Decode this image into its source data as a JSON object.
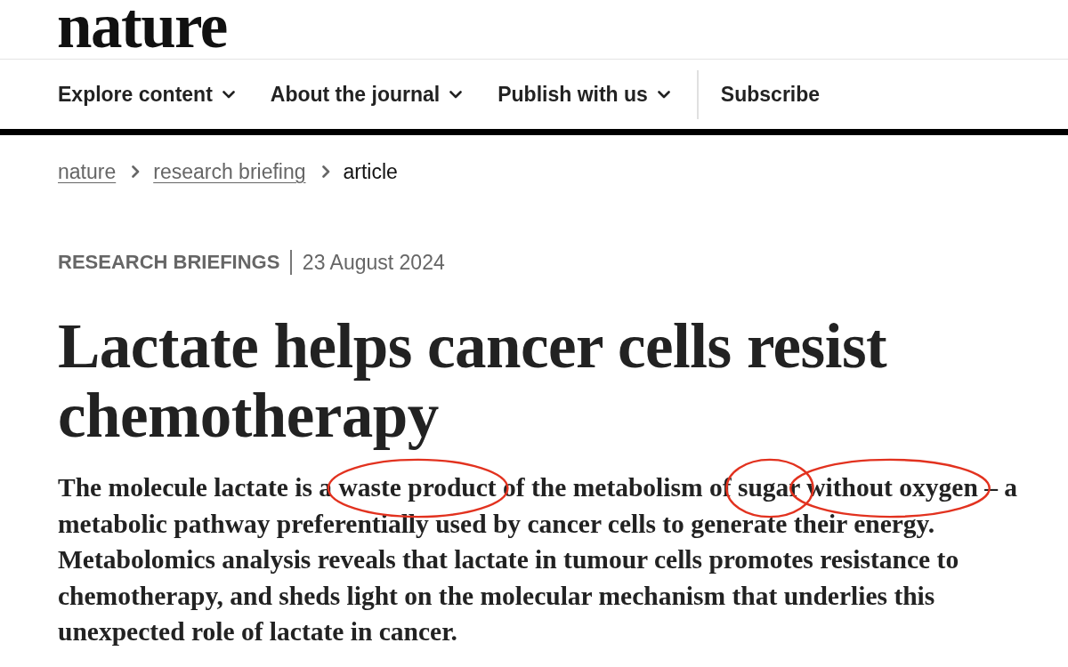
{
  "header": {
    "logo": "nature"
  },
  "nav": {
    "items": [
      {
        "label": "Explore content",
        "kind": "menu"
      },
      {
        "label": "About the journal",
        "kind": "menu"
      },
      {
        "label": "Publish with us",
        "kind": "menu"
      },
      {
        "label": "Subscribe",
        "kind": "link"
      }
    ]
  },
  "breadcrumb": [
    {
      "label": "nature",
      "kind": "link"
    },
    {
      "label": "research briefing",
      "kind": "link"
    },
    {
      "label": "article",
      "kind": "current"
    }
  ],
  "article": {
    "type": "RESEARCH BRIEFINGS",
    "date": "23 August 2024",
    "title": "Lactate helps cancer cells resist chemotherapy",
    "standfirst": [
      {
        "text": "The molecule lactate is a ",
        "circled": false
      },
      {
        "text": "waste product",
        "circled": true
      },
      {
        "text": " of the metabolism of ",
        "circled": false
      },
      {
        "text": "sugar",
        "circled": true
      },
      {
        "text": " without oxygen",
        "circled": true
      },
      {
        "text": " – a metabolic pathway preferentially used by cancer cells to generate their energy. Metabolomics analysis reveals that lactate in tumour cells promotes resistance to chemotherapy, and sheds light on the molecular mechanism that underlies this unexpected role of lactate in cancer.",
        "circled": false
      }
    ]
  }
}
